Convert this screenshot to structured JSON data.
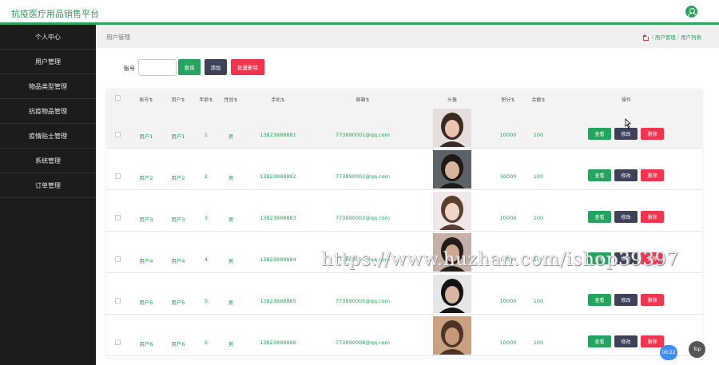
{
  "header": {
    "title": "抗疫医疗用品销售平台",
    "user_icon": "user-icon"
  },
  "sidebar": {
    "items": [
      {
        "label": "个人中心"
      },
      {
        "label": "用户管理"
      },
      {
        "label": "物品类型管理"
      },
      {
        "label": "抗疫物品管理"
      },
      {
        "label": "疫情贴士管理"
      },
      {
        "label": "系统管理"
      },
      {
        "label": "订单管理"
      }
    ]
  },
  "crumbbar": {
    "title": "用户管理",
    "path": [
      "用户管理",
      "用户列表"
    ],
    "home_icon": "home-icon"
  },
  "search": {
    "label": "账号",
    "value": "",
    "search_button": "查询",
    "add_button": "添加",
    "batch_delete_button": "批量删除"
  },
  "table": {
    "headers": [
      "账号⇅",
      "用户⇅",
      "年龄⇅",
      "性别⇅",
      "手机⇅",
      "邮箱⇅",
      "头像",
      "积分⇅",
      "余额⇅",
      "操作"
    ],
    "action_labels": {
      "view": "查看",
      "edit": "修改",
      "delete": "删除"
    },
    "rows": [
      {
        "account": "用户1",
        "user": "用户1",
        "age": "1",
        "gender": "男",
        "phone": "13823888881",
        "email": "773890001@qq.com",
        "points": "10000",
        "balance": "100",
        "hover": true
      },
      {
        "account": "用户2",
        "user": "用户2",
        "age": "2",
        "gender": "男",
        "phone": "13823888882",
        "email": "773890002@qq.com",
        "points": "10000",
        "balance": "100",
        "hover": false
      },
      {
        "account": "用户3",
        "user": "用户3",
        "age": "3",
        "gender": "男",
        "phone": "13823888883",
        "email": "773890003@qq.com",
        "points": "10000",
        "balance": "100",
        "hover": false
      },
      {
        "account": "用户4",
        "user": "用户4",
        "age": "4",
        "gender": "男",
        "phone": "13823888884",
        "email": "773890004@qq.com",
        "points": "10000",
        "balance": "100",
        "hover": false
      },
      {
        "account": "用户5",
        "user": "用户5",
        "age": "5",
        "gender": "男",
        "phone": "13823888885",
        "email": "773890005@qq.com",
        "points": "10000",
        "balance": "100",
        "hover": false
      },
      {
        "account": "用户6",
        "user": "用户6",
        "age": "6",
        "gender": "男",
        "phone": "13823888886",
        "email": "773890006@qq.com",
        "points": "10000",
        "balance": "100",
        "hover": false
      }
    ]
  },
  "colors": {
    "accent": "#2aa55a",
    "dark_button": "#3e4257",
    "danger": "#f0364f",
    "sidebar_bg": "#1c1c1c"
  },
  "watermark": "https://www.huzhan.com/ishop39397",
  "timer": "00:22",
  "top_button": "Top"
}
